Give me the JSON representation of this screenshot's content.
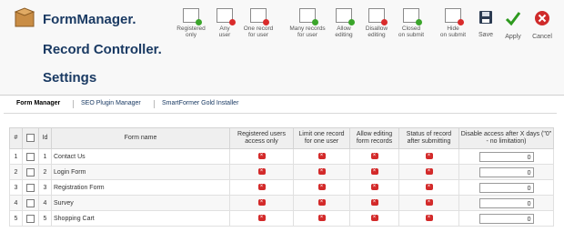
{
  "header": {
    "title_lines": [
      "FormManager.",
      "Record Controller.",
      "Settings"
    ]
  },
  "toolbar": [
    {
      "id": "registered-only",
      "label": "Registered\nonly",
      "status": "green"
    },
    {
      "id": "any-user",
      "label": "Any\nuser",
      "status": "red"
    },
    {
      "id": "one-record",
      "label": "One record\nfor user",
      "status": "red"
    },
    {
      "id": "many-records",
      "label": "Many records\nfor user",
      "status": "green"
    },
    {
      "id": "allow-editing",
      "label": "Allow\nediting",
      "status": "green"
    },
    {
      "id": "disallow-editing",
      "label": "Disallow\nediting",
      "status": "red"
    },
    {
      "id": "closed-on-submit",
      "label": "Closed\non submit",
      "status": "green"
    },
    {
      "id": "open-on-submit",
      "label": "Hide\non submit",
      "status": "red"
    },
    {
      "id": "save",
      "label": "Save",
      "icon": "floppy-disk-icon"
    },
    {
      "id": "apply",
      "label": "Apply",
      "icon": "check-icon"
    },
    {
      "id": "cancel",
      "label": "Cancel",
      "icon": "cancel-icon"
    }
  ],
  "tabs": [
    "Form Manager",
    "SEO Plugin Manager",
    "SmartFormer Gold Installer"
  ],
  "table": {
    "headers": [
      "#",
      "",
      "Id",
      "Form name",
      "Registered users access only",
      "Limit one record for one user",
      "Allow editing form records",
      "Status of record after submitting",
      "Disable access after X days (\"0\" - no limitation)"
    ],
    "rows": [
      {
        "num": "1",
        "id": "1",
        "name": "Contact Us",
        "days": "0"
      },
      {
        "num": "2",
        "id": "2",
        "name": "Login Form",
        "days": "0"
      },
      {
        "num": "3",
        "id": "3",
        "name": "Registration Form",
        "days": "0"
      },
      {
        "num": "4",
        "id": "4",
        "name": "Survey",
        "days": "0"
      },
      {
        "num": "5",
        "id": "5",
        "name": "Shopping Cart",
        "days": "0"
      }
    ]
  }
}
